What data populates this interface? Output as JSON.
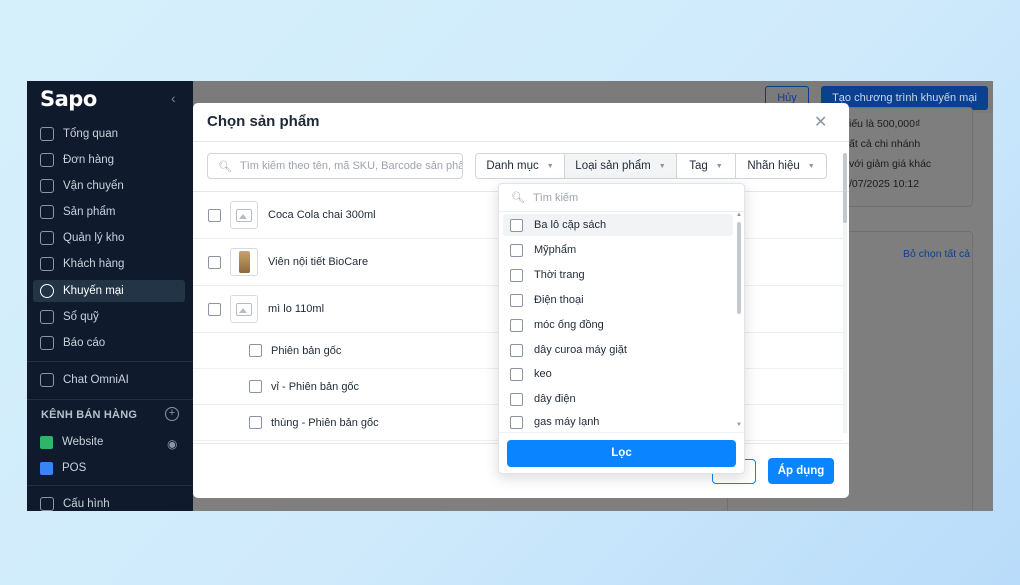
{
  "sidebar": {
    "logo": "Sapo",
    "collapse_icon": "‹",
    "items": [
      {
        "label": "Tổng quan"
      },
      {
        "label": "Đơn hàng"
      },
      {
        "label": "Vận chuyển"
      },
      {
        "label": "Sản phẩm"
      },
      {
        "label": "Quản lý kho"
      },
      {
        "label": "Khách hàng"
      },
      {
        "label": "Khuyến mại",
        "active": true
      },
      {
        "label": "Sổ quỹ"
      },
      {
        "label": "Báo cáo"
      },
      {
        "label": "Chat OmniAI"
      }
    ],
    "channels_heading": "KÊNH BÁN HÀNG",
    "channels": [
      {
        "label": "Website",
        "color": "#2fb56a"
      },
      {
        "label": "POS",
        "color": "#3b82f6"
      }
    ],
    "config": "Cấu hình"
  },
  "page": {
    "cancel_label": "Hủy",
    "create_label": "Tạo chương trình khuyến mại",
    "info_lines": [
      "iếu là 500,000₫",
      "ất cả chi nhánh",
      "với giảm giá khác",
      "/07/2025 10:12"
    ],
    "deselect_all": "Bỏ chọn tất cả"
  },
  "modal": {
    "title": "Chọn sản phẩm",
    "search_placeholder": "Tìm kiếm theo tên, mã SKU, Barcode sản phẩ",
    "filters": [
      {
        "label": "Danh mục"
      },
      {
        "label": "Loại sản phẩm",
        "active": true
      },
      {
        "label": "Tag"
      },
      {
        "label": "Nhãn hiệu"
      }
    ],
    "products": [
      {
        "name": "Coca Cola chai 300ml"
      },
      {
        "name": "Viên nội tiết BioCare"
      },
      {
        "name": "mì lo 110ml"
      }
    ],
    "variants": [
      {
        "name": "Phiên bản gốc"
      },
      {
        "name": "vỉ - Phiên bản gốc"
      },
      {
        "name": "thùng - Phiên bản gốc"
      }
    ],
    "apply_label": "Áp dụng"
  },
  "dropdown": {
    "search_placeholder": "Tìm kiếm",
    "options": [
      "Ba lô cặp sách",
      "Mỹphẩm",
      "Thời trang",
      "Điện thoại",
      "móc ống đồng",
      "dây curoa máy giặt",
      "keo",
      "dây điện",
      "gas máy lạnh"
    ],
    "filter_button": "Lọc"
  },
  "colors": {
    "primary": "#0a84ff",
    "sidebar_bg": "#0f1b2d"
  }
}
